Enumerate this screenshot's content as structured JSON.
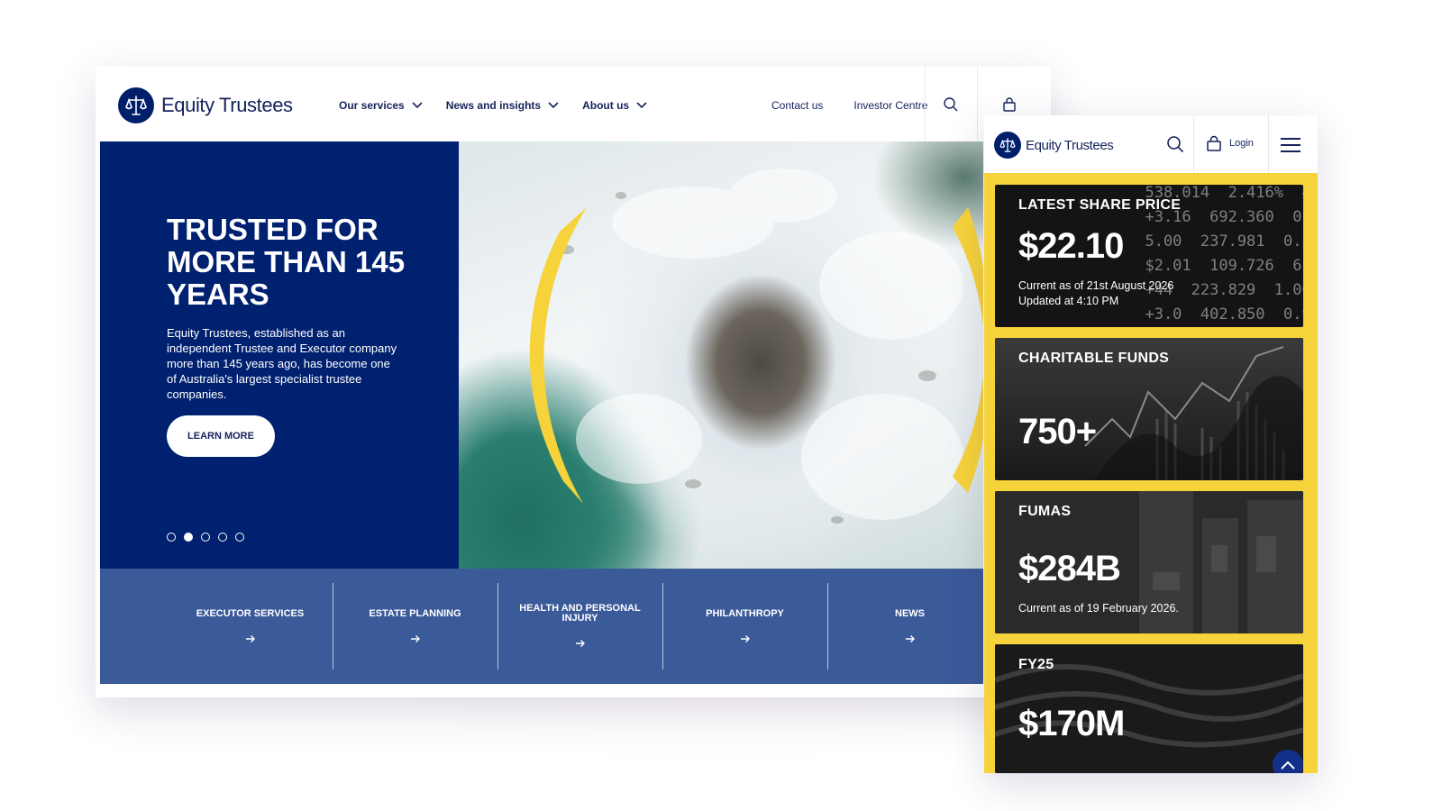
{
  "brand": {
    "name": "Equity Trustees"
  },
  "desktop": {
    "nav": {
      "menu": [
        {
          "label": "Our services"
        },
        {
          "label": "News and insights"
        },
        {
          "label": "About us"
        }
      ],
      "links": [
        {
          "label": "Contact us"
        },
        {
          "label": "Investor Centre"
        }
      ]
    },
    "hero": {
      "title": "TRUSTED FOR MORE THAN 145 YEARS",
      "text": "Equity Trustees, established as an independent Trustee and Executor company more than 145 years ago, has become one of Australia's largest specialist trustee companies.",
      "button": "LEARN MORE",
      "slides": {
        "total": 5,
        "active_index": 1
      }
    },
    "services": [
      {
        "label": "EXECUTOR SERVICES"
      },
      {
        "label": "ESTATE PLANNING"
      },
      {
        "label": "HEALTH AND PERSONAL INJURY"
      },
      {
        "label": "PHILANTHROPY"
      },
      {
        "label": "NEWS"
      }
    ]
  },
  "mobile": {
    "nav": {
      "login": "Login"
    },
    "stats": [
      {
        "label": "LATEST SHARE PRICE",
        "value": "$22.10",
        "note1": "Current as of 21st August 2026",
        "note2": "Updated at 4:10 PM"
      },
      {
        "label": "CHARITABLE FUNDS",
        "value": "750+"
      },
      {
        "label": "FUMAS",
        "value": "$284B",
        "note1": "Current as of 19 February 2026."
      },
      {
        "label": "FY25",
        "value": "$170M"
      }
    ]
  },
  "colors": {
    "navy": "#002170",
    "brand_text": "#14225b",
    "services_blue": "#3b5a9a",
    "accent_yellow": "#f6d33b"
  },
  "icons": [
    "logo-scales-icon",
    "chevron-down-icon",
    "search-icon",
    "bag-icon",
    "arrow-right-icon",
    "hamburger-icon",
    "chevron-up-icon"
  ]
}
